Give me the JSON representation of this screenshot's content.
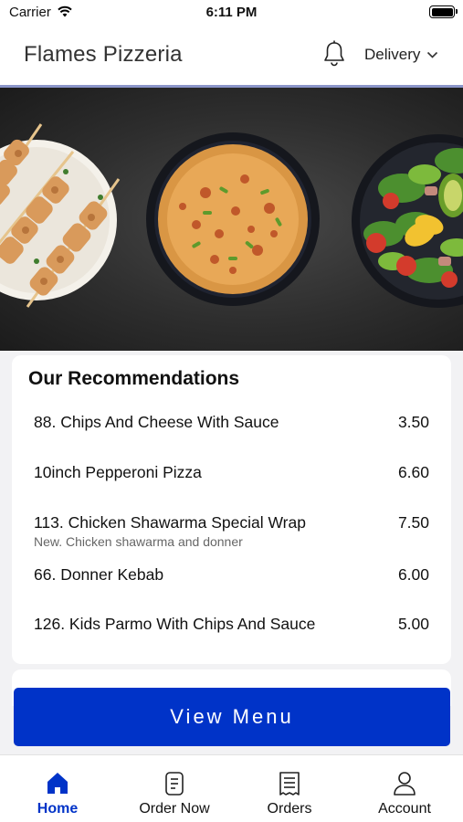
{
  "status_bar": {
    "carrier": "Carrier",
    "time": "6:11 PM"
  },
  "header": {
    "title": "Flames Pizzeria",
    "mode": "Delivery",
    "icons": [
      "bell-icon",
      "chevron-down-icon"
    ]
  },
  "recommendations": {
    "title": "Our Recommendations",
    "items": [
      {
        "name": "88. Chips And Cheese With Sauce",
        "price": "3.50",
        "description": ""
      },
      {
        "name": "10inch Pepperoni Pizza",
        "price": "6.60",
        "description": ""
      },
      {
        "name": "113. Chicken Shawarma Special Wrap",
        "price": "7.50",
        "description": "New. Chicken shawarma and donner"
      },
      {
        "name": "66. Donner Kebab",
        "price": "6.00",
        "description": ""
      },
      {
        "name": "126. Kids Parmo With Chips And Sauce",
        "price": "5.00",
        "description": ""
      }
    ]
  },
  "view_menu_label": "View Menu",
  "nav": {
    "items": [
      {
        "label": "Home",
        "icon": "home-icon",
        "active": true
      },
      {
        "label": "Order Now",
        "icon": "order-icon",
        "active": false
      },
      {
        "label": "Orders",
        "icon": "receipt-icon",
        "active": false
      },
      {
        "label": "Account",
        "icon": "person-icon",
        "active": false
      }
    ]
  },
  "colors": {
    "accent": "#0033c8",
    "header_divider": "#8b95c9",
    "background": "#f2f2f4"
  }
}
